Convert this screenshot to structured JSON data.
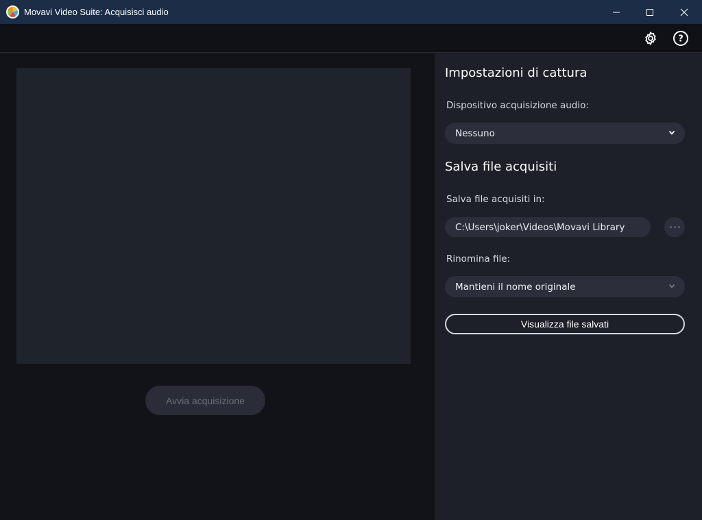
{
  "window": {
    "title": "Movavi Video Suite: Acquisisci audio",
    "controls": [
      "minimize-icon",
      "maximize-icon",
      "close-icon"
    ]
  },
  "toolbar": {
    "icons": [
      "gear-icon",
      "help-icon"
    ],
    "help_glyph": "?"
  },
  "main": {
    "start_button_label": "Avvia acquisizione"
  },
  "settings": {
    "capture_heading": "Impostazioni di cattura",
    "device_label": "Dispositivo acquisizione audio:",
    "device_value": "Nessuno",
    "save_heading": "Salva file acquisiti",
    "save_in_label": "Salva file acquisiti in:",
    "save_path": "C:\\Users\\joker\\Videos\\Movavi Library",
    "rename_label": "Rinomina file:",
    "rename_value": "Mantieni il nome originale",
    "view_files_label": "Visualizza file salvati"
  },
  "colors": {
    "titlebar": "#1b2d47",
    "panel": "#1e2029",
    "field": "#2c2f3b",
    "text": "#ffffff"
  }
}
